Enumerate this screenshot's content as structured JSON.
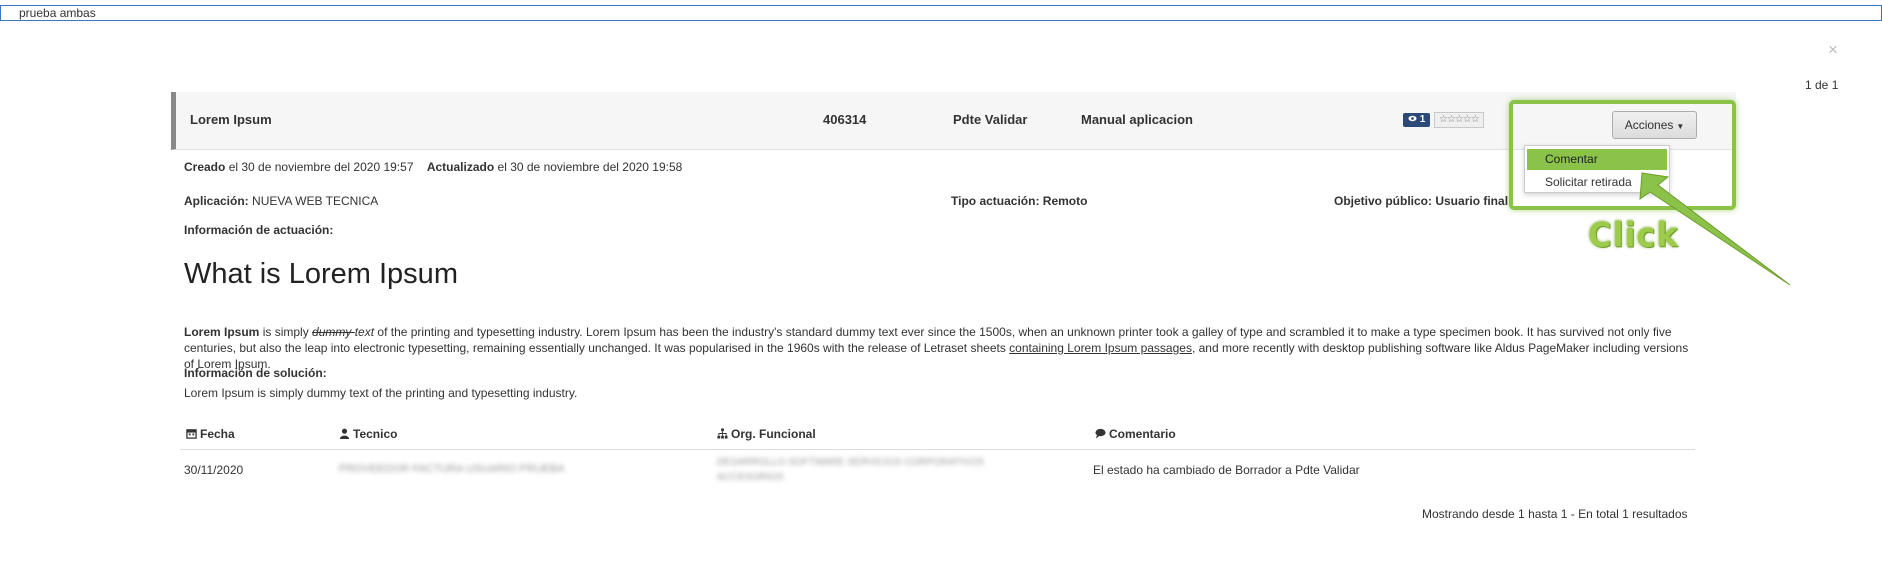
{
  "search": {
    "value": "prueba ambas"
  },
  "modal": {
    "close_label": "×",
    "pager": "1 de 1"
  },
  "record": {
    "title": "Lorem Ipsum",
    "number": "406314",
    "status": "Pdte Validar",
    "category": "Manual aplicacion",
    "views": "1",
    "rating": "☆☆☆☆☆",
    "actions_label": "Acciones"
  },
  "dropdown": {
    "items": [
      {
        "label": "Comentar"
      },
      {
        "label": "Solicitar retirada"
      }
    ]
  },
  "annotation": {
    "label": "Click",
    "color": "#8bc34a"
  },
  "meta": {
    "created_label": "Creado",
    "created_value": "el 30 de noviembre del 2020 19:57",
    "updated_label": "Actualizado",
    "updated_value": "el 30 de noviembre del 2020 19:58",
    "app_label": "Aplicación:",
    "app_value": "NUEVA WEB TECNICA",
    "type_label": "Tipo actuación:",
    "type_value": "Remoto",
    "target_label": "Objetivo público:",
    "target_value": "Usuario final",
    "info_label": "Información de actuación:",
    "solution_label": "Información de solución:",
    "solution_text": "Lorem Ipsum is simply dummy text of the printing and typesetting industry."
  },
  "content": {
    "heading": "What is Lorem Ipsum",
    "p_bold": "Lorem Ipsum",
    "p_1": " is simply ",
    "p_strike": "dummy ",
    "p_ital": "text",
    "p_2": " of the printing and typesetting industry. Lorem Ipsum has been the industry's standard dummy text ever since the 1500s, when an unknown printer took a galley of type and scrambled it to make a type specimen book. It has survived not only five centuries, but also the leap into electronic typesetting, remaining essentially unchanged. It was popularised in the 1960s with the release of Letraset sheets ",
    "p_link": "containing Lorem Ipsum passages",
    "p_3": ", and more recently with desktop publishing software like Aldus PageMaker including versions of Lorem Ipsum."
  },
  "table": {
    "headers": {
      "date": "Fecha",
      "tech": "Tecnico",
      "org": "Org. Funcional",
      "comment": "Comentario"
    },
    "rows": [
      {
        "date": "30/11/2020",
        "tech": "PROVEEDOR FACTURA USUARIO PRUEBA",
        "org": "DESARROLLO SOFTWARE SERVICIOS CORPORATIVOS ACCESORIOS",
        "comment": "El estado ha cambiado de Borrador a Pdte Validar"
      }
    ],
    "footer": "Mostrando desde 1 hasta 1 - En total 1 resultados"
  }
}
